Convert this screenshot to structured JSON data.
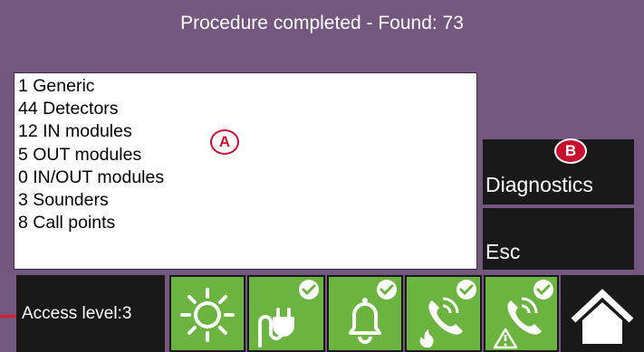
{
  "header": {
    "title": "Procedure completed - Found: 73"
  },
  "results": {
    "lines": [
      "1 Generic",
      "44 Detectors",
      "12 IN modules",
      "5 OUT modules",
      "0 IN/OUT modules",
      "3 Sounders",
      "8 Call points"
    ]
  },
  "markers": {
    "a": "A",
    "b": "B"
  },
  "buttons": {
    "diagnostics": "Diagnostics",
    "esc": "Esc"
  },
  "status_bar": {
    "access_level": "Access level:3",
    "icons": [
      "sun-icon",
      "power-plug-icon",
      "bell-icon",
      "phone-fire-icon",
      "phone-warning-icon",
      "home-icon"
    ]
  },
  "colors": {
    "background": "#74577f",
    "panel": "#191919",
    "status_ok": "#6ab43f",
    "marker": "#c8102e"
  }
}
